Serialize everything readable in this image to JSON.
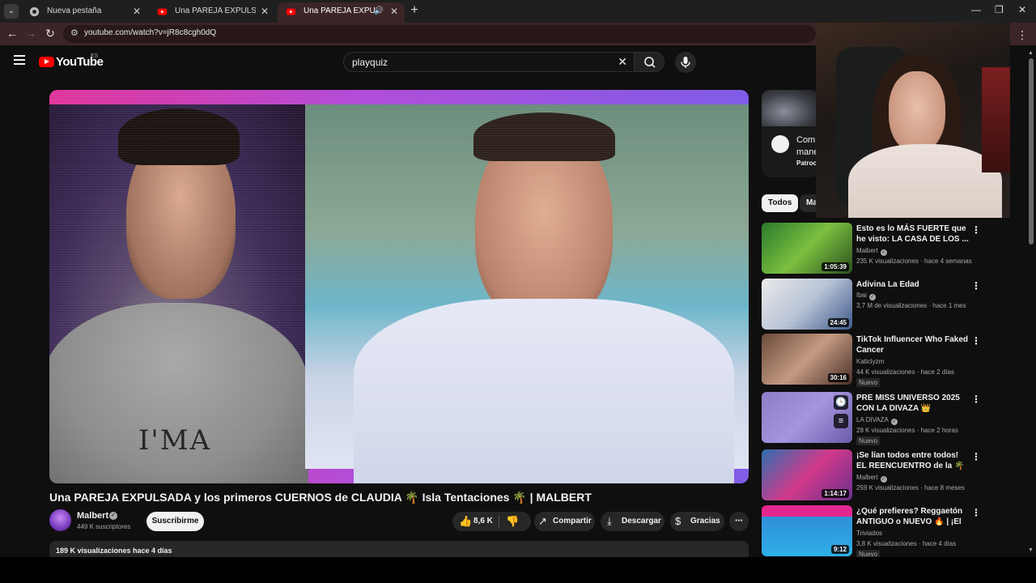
{
  "browser": {
    "tabs": [
      {
        "label": "Nueva pestaña",
        "favicon": "chrome-icon",
        "active": false
      },
      {
        "label": "Una PAREJA EXPULSADA y los p",
        "favicon": "youtube-icon",
        "active": false
      },
      {
        "label": "Una PAREJA EXPULSADA y",
        "favicon": "youtube-icon",
        "active": true,
        "audio": true
      }
    ],
    "url": "youtube.com/watch?v=jR8c8cgh0dQ",
    "theme_color": "#3c2526"
  },
  "header": {
    "logo_text": "YouTube",
    "region": "ES",
    "search_query": "playquiz"
  },
  "video": {
    "title": "Una PAREJA EXPULSADA y los primeros CUERNOS de CLAUDIA 🌴 Isla Tentaciones 🌴 | MALBERT",
    "shirt_text": "I'MA",
    "channel": {
      "name": "Malbert",
      "subscribers": "449 K suscriptores"
    },
    "subscribe_label": "Suscribirme",
    "likes": "8,6 K",
    "share_label": "Compartir",
    "download_label": "Descargar",
    "thanks_label": "Gracias",
    "views": "189 K visualizaciones",
    "age": "hace 4 días"
  },
  "sidebar": {
    "ad": {
      "title_line1": "Com",
      "title_line2": "mane",
      "sponsor": "Patroc"
    },
    "chips": [
      "Todos",
      "Ma"
    ],
    "recommendations": [
      {
        "title": "Esto es lo MÁS FUERTE que he visto: LA CASA DE LOS ...",
        "channel": "Malbert",
        "verified": true,
        "views": "235 K visualizaciones",
        "age": "hace 4 semanas",
        "duration": "1:05:39",
        "badge": ""
      },
      {
        "title": "Adivina La Edad",
        "channel": "Ibai",
        "verified": true,
        "views": "3,7 M de visualizaciones",
        "age": "hace 1 mes",
        "duration": "24:45",
        "badge": ""
      },
      {
        "title": "TikTok Influencer Who Faked Cancer",
        "channel": "Katiclyzm",
        "verified": false,
        "views": "44 K visualizaciones",
        "age": "hace 2 días",
        "duration": "30:16",
        "badge": "Nuevo"
      },
      {
        "title": "PRE MISS UNIVERSO 2025 CON LA DIVAZA 👑",
        "channel": "LA DIVAZA",
        "verified": true,
        "views": "28 K visualizaciones",
        "age": "hace 2 horas",
        "duration": "",
        "badge": "Nuevo"
      },
      {
        "title": "¡Se lían todos entre todos! EL REENCUENTRO de la 🌴 Isla ...",
        "channel": "Malbert",
        "verified": true,
        "views": "259 K visualizaciones",
        "age": "hace 8 meses",
        "duration": "1:14:17",
        "badge": ""
      },
      {
        "title": "¿Qué prefieres? Reggaetón ANTIGUO o NUEVO 🔥 | ¡El ...",
        "channel": "Triviados",
        "verified": false,
        "views": "3,8 K visualizaciones",
        "age": "hace 4 días",
        "duration": "9:12",
        "badge": "Nuevo"
      }
    ]
  }
}
